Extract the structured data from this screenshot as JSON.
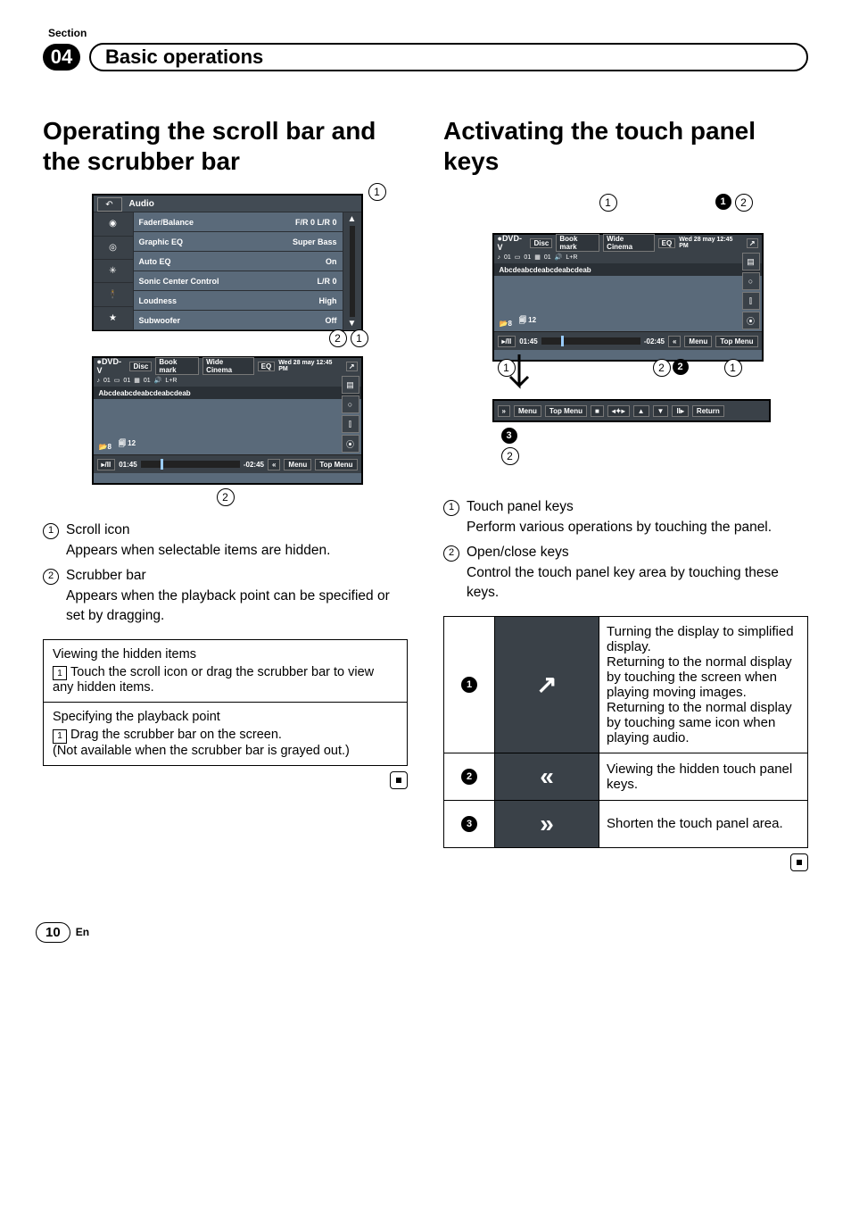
{
  "header": {
    "section_label": "Section",
    "number": "04",
    "title": "Basic operations"
  },
  "left": {
    "heading": "Operating the scroll bar and the scrubber bar",
    "audio_mock": {
      "title": "Audio",
      "rows": [
        {
          "label": "Fader/Balance",
          "value": "F/R  0 L/R  0"
        },
        {
          "label": "Graphic EQ",
          "value": "Super Bass"
        },
        {
          "label": "Auto EQ",
          "value": "On"
        },
        {
          "label": "Sonic Center Control",
          "value": "L/R  0"
        },
        {
          "label": "Loudness",
          "value": "High"
        },
        {
          "label": "Subwoofer",
          "value": "Off"
        }
      ],
      "callout_top": "1",
      "callout_bot_a": "2",
      "callout_bot_b": "1"
    },
    "dvd_mock": {
      "src": "DVD-V",
      "top_pills": [
        "Disc",
        "Book mark",
        "Wide Cinema",
        "",
        "EQ",
        "",
        "Wed 28 may 12:45 PM"
      ],
      "mid": [
        "01",
        "01",
        "01",
        "L+R"
      ],
      "song": "Abcdeabcdeabcdeabcdeab",
      "counts": [
        "8",
        "12"
      ],
      "time_elapsed": "01:45",
      "time_remain": "-02:45",
      "right_buttons": [
        "«",
        "Menu",
        "Top Menu"
      ],
      "callout_bottom": "2"
    },
    "list": [
      {
        "num": "1",
        "label": "Scroll icon",
        "sub": "Appears when selectable items are hidden."
      },
      {
        "num": "2",
        "label": "Scrubber bar",
        "sub": "Appears when the playback point can be specified or set by dragging."
      }
    ],
    "box": [
      {
        "title": "Viewing the hidden items",
        "step_num": "1",
        "step": "Touch the scroll icon or drag the scrubber bar to view any hidden items."
      },
      {
        "title": "Specifying the playback point",
        "step_num": "1",
        "step": "Drag the scrubber bar on the screen.\n(Not available when the scrubber bar is grayed out.)"
      }
    ]
  },
  "right": {
    "heading": "Activating the touch panel keys",
    "diagram": {
      "circ_top_left": "1",
      "dot_top": "1",
      "circ_top_right": "2",
      "circ_mid_left": "1",
      "circ_mid_right_a": "2",
      "dot_mid": "2",
      "circ_mid_right_b": "1",
      "dot_bot": "3",
      "circ_bot": "2",
      "lower_buttons": [
        "Menu",
        "Top Menu",
        "■",
        "◂✦▸",
        "▲",
        "▼",
        "II▸",
        "Return"
      ],
      "dvd": {
        "src": "DVD-V",
        "top_pills": [
          "Disc",
          "Book mark",
          "Wide Cinema",
          "",
          "EQ",
          "",
          "Wed 28 may 12:45 PM"
        ],
        "mid": [
          "01",
          "01",
          "01",
          "L+R"
        ],
        "song": "Abcdeabcdeabcdeabcdeab",
        "counts": [
          "8",
          "12"
        ],
        "time_elapsed": "01:45",
        "time_remain": "-02:45",
        "right_buttons": [
          "«",
          "Menu",
          "Top Menu"
        ]
      }
    },
    "list": [
      {
        "num": "1",
        "label": "Touch panel keys",
        "sub": "Perform various operations by touching the panel."
      },
      {
        "num": "2",
        "label": "Open/close keys",
        "sub": "Control the touch panel key area by touching these keys."
      }
    ],
    "table": [
      {
        "dot": "1",
        "glyph": "↗",
        "desc": "Turning the display to simplified display.\nReturning to the normal display by touching the screen when playing moving images.\nReturning to the normal display by touching same icon when playing audio."
      },
      {
        "dot": "2",
        "glyph": "«",
        "desc": "Viewing the hidden touch panel keys."
      },
      {
        "dot": "3",
        "glyph": "»",
        "desc": "Shorten the touch panel area."
      }
    ]
  },
  "footer": {
    "page": "10",
    "lang": "En"
  }
}
